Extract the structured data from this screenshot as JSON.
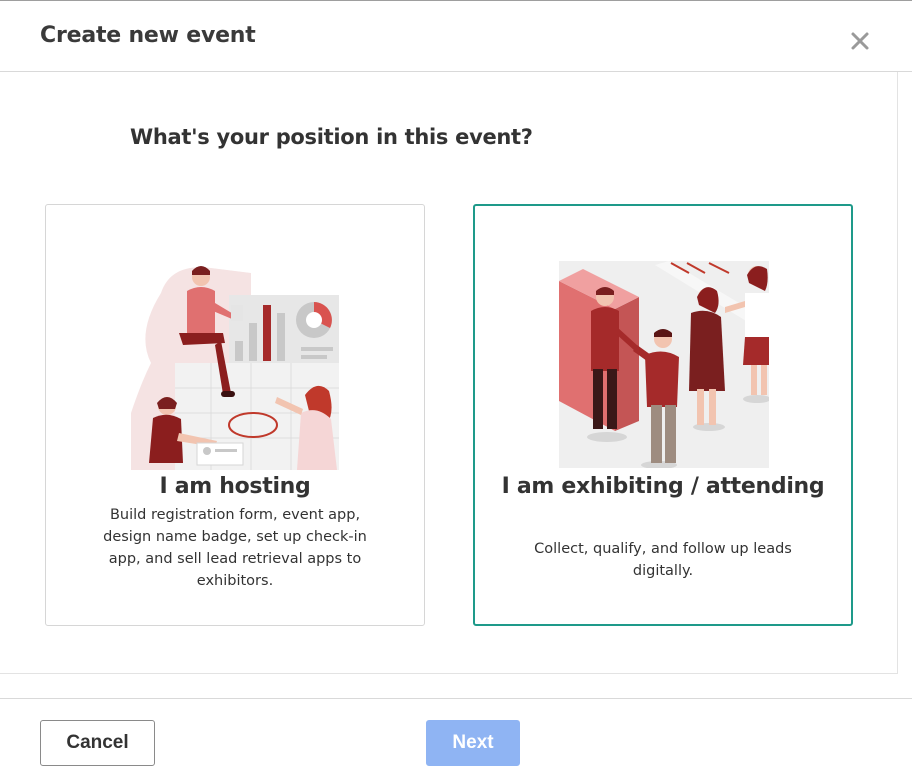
{
  "dialog": {
    "title": "Create new event",
    "close_icon": "close-icon"
  },
  "question": "What's your position in this event?",
  "options": [
    {
      "title": "I am hosting",
      "description": "Build registration form, event app, design name badge, set up check-in app, and sell lead retrieval apps to exhibitors.",
      "illustration": "hosting-illustration",
      "selected": false
    },
    {
      "title": "I am exhibiting / attending",
      "description": "Collect, qualify, and follow up leads digitally.",
      "illustration": "exhibiting-illustration",
      "selected": true
    }
  ],
  "footer": {
    "cancel_label": "Cancel",
    "next_label": "Next"
  },
  "colors": {
    "accent_selected_border": "#1e9a8a",
    "next_button_disabled": "#8fb4f3",
    "illustration_red": "#a52a2a",
    "illustration_light_red": "#e08080"
  }
}
